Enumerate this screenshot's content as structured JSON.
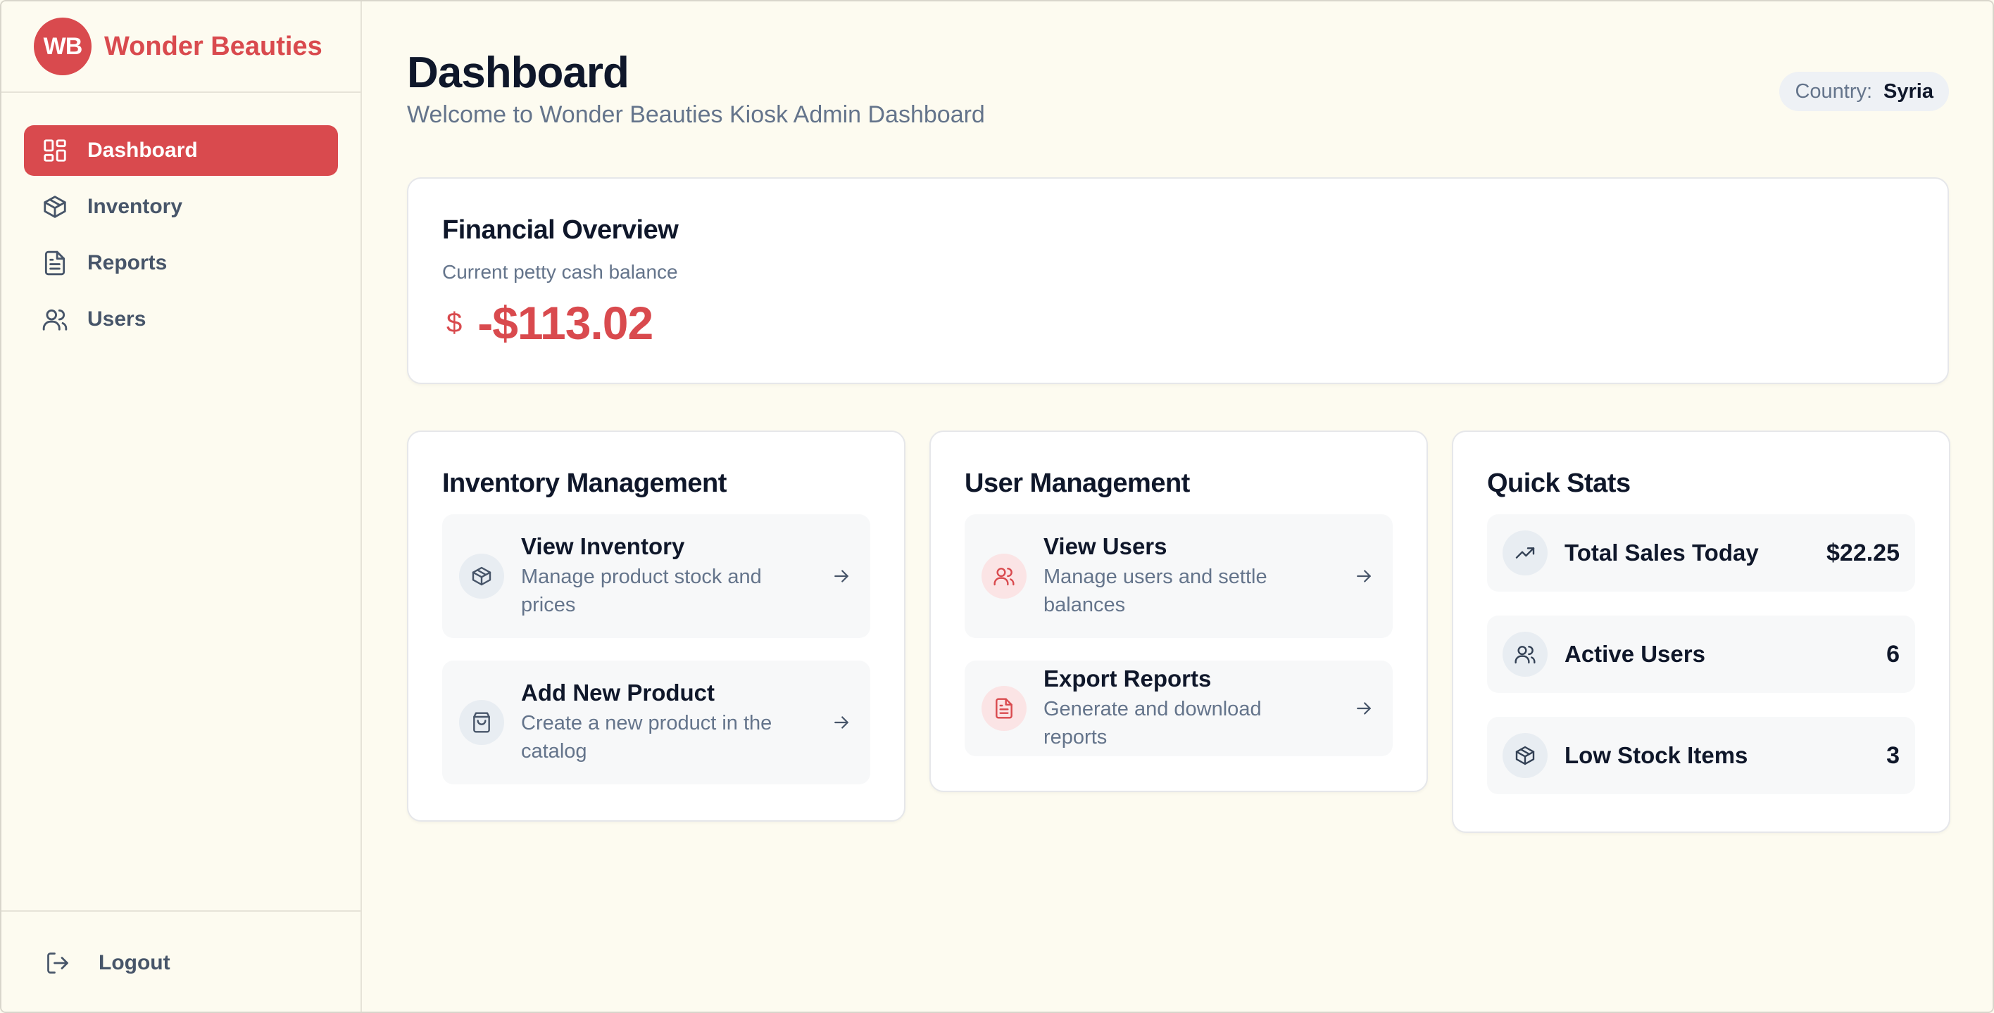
{
  "brand": {
    "initials": "WB",
    "name": "Wonder Beauties"
  },
  "nav": [
    {
      "label": "Dashboard",
      "icon": "dashboard-icon",
      "active": true
    },
    {
      "label": "Inventory",
      "icon": "box-icon",
      "active": false
    },
    {
      "label": "Reports",
      "icon": "document-icon",
      "active": false
    },
    {
      "label": "Users",
      "icon": "users-icon",
      "active": false
    }
  ],
  "logout_label": "Logout",
  "header": {
    "title": "Dashboard",
    "subtitle": "Welcome to Wonder Beauties Kiosk Admin Dashboard",
    "country_label": "Country:",
    "country_value": "Syria"
  },
  "financial": {
    "title": "Financial Overview",
    "subtitle": "Current petty cash balance",
    "currency_symbol": "$",
    "amount": "-$113.02"
  },
  "inventory_management": {
    "title": "Inventory Management",
    "actions": [
      {
        "title": "View Inventory",
        "description": "Manage product stock and prices",
        "icon": "box-icon"
      },
      {
        "title": "Add New Product",
        "description": "Create a new product in the catalog",
        "icon": "shopping-bag-icon"
      }
    ]
  },
  "user_management": {
    "title": "User Management",
    "actions": [
      {
        "title": "View Users",
        "description": "Manage users and settle balances",
        "icon": "users-icon"
      },
      {
        "title": "Export Reports",
        "description": "Generate and download reports",
        "icon": "document-icon"
      }
    ]
  },
  "quick_stats": {
    "title": "Quick Stats",
    "items": [
      {
        "label": "Total Sales Today",
        "value": "$22.25",
        "icon": "trending-up-icon"
      },
      {
        "label": "Active Users",
        "value": "6",
        "icon": "users-icon"
      },
      {
        "label": "Low Stock Items",
        "value": "3",
        "icon": "box-icon"
      }
    ]
  },
  "colors": {
    "accent": "#d94a4e",
    "background": "#fdfbf0",
    "muted_text": "#64748b"
  }
}
